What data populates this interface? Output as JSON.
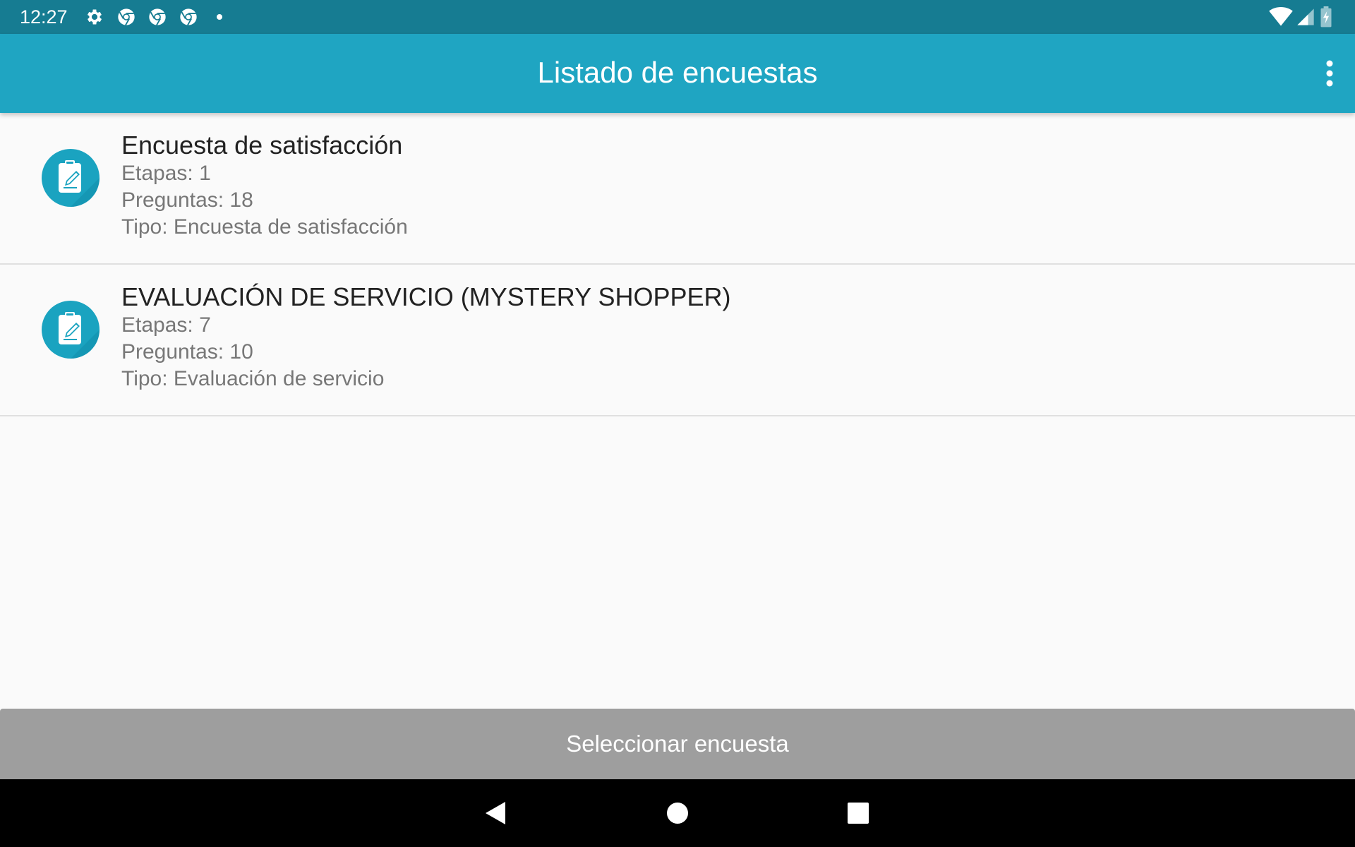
{
  "status_bar": {
    "time": "12:27",
    "left_icons": [
      "gear-icon",
      "chrome-icon",
      "chrome-icon",
      "chrome-icon",
      "dot-icon"
    ],
    "right_icons": [
      "wifi-icon",
      "signal-icon",
      "battery-charging-icon"
    ]
  },
  "app_bar": {
    "title": "Listado de encuestas",
    "menu_icon": "more-vert-icon"
  },
  "surveys": [
    {
      "title": "Encuesta de satisfacción",
      "stages": "Etapas: 1",
      "questions": "Preguntas: 18",
      "type": "Tipo: Encuesta de satisfacción",
      "icon": "clipboard-edit-icon"
    },
    {
      "title": "EVALUACIÓN DE SERVICIO (MYSTERY SHOPPER)",
      "stages": "Etapas: 7",
      "questions": "Preguntas: 10",
      "type": "Tipo: Evaluación de servicio",
      "icon": "clipboard-edit-icon"
    }
  ],
  "footer": {
    "select_label": "Seleccionar encuesta"
  },
  "nav_bar": {
    "buttons": [
      "back-icon",
      "home-icon",
      "recents-icon"
    ]
  },
  "colors": {
    "status_bar": "#167c92",
    "app_bar": "#1fa5c2",
    "icon_circle": "#1aa3c0",
    "button_disabled": "#9e9e9e",
    "background": "#fafafa"
  }
}
